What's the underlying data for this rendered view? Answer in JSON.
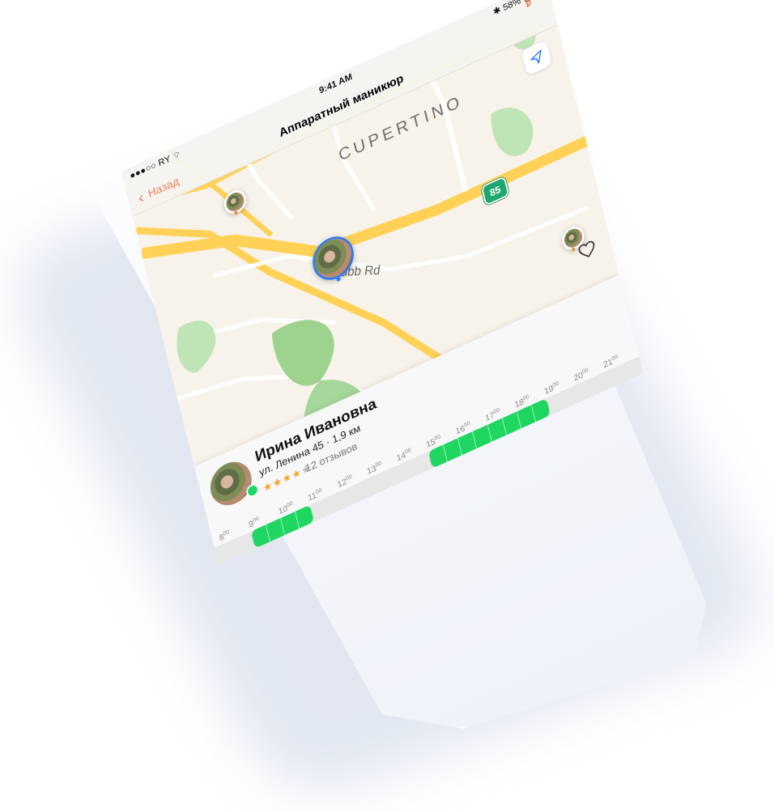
{
  "status": {
    "carrier": "RY",
    "time": "9:41 AM",
    "battery": "58%"
  },
  "header": {
    "back_label": "Назад",
    "title": "Аппаратный маникюр"
  },
  "map": {
    "city_label": "CUPERTINO",
    "street_label": "Bubb Rd",
    "highway_label": "85"
  },
  "card": {
    "name": "Ирина Ивановна",
    "address_line": "ул. Ленина 45 · 1,9 км",
    "stars_on": "★★★★",
    "stars_off": "★",
    "reviews": "12 отзывов",
    "rating": 4
  },
  "timeline": {
    "hours": [
      "8",
      "9",
      "10",
      "11",
      "12",
      "13",
      "14",
      "15",
      "16",
      "17",
      "18",
      "19",
      "20",
      "21"
    ],
    "minutes_label": "00",
    "available_ranges": [
      [
        "9:00",
        "11:00"
      ],
      [
        "15:00",
        "19:00"
      ]
    ]
  },
  "colors": {
    "accent": "#f07d57",
    "slot_green": "#1fd661",
    "pin_blue": "#2c7df7",
    "map_road": "#ffd257"
  }
}
